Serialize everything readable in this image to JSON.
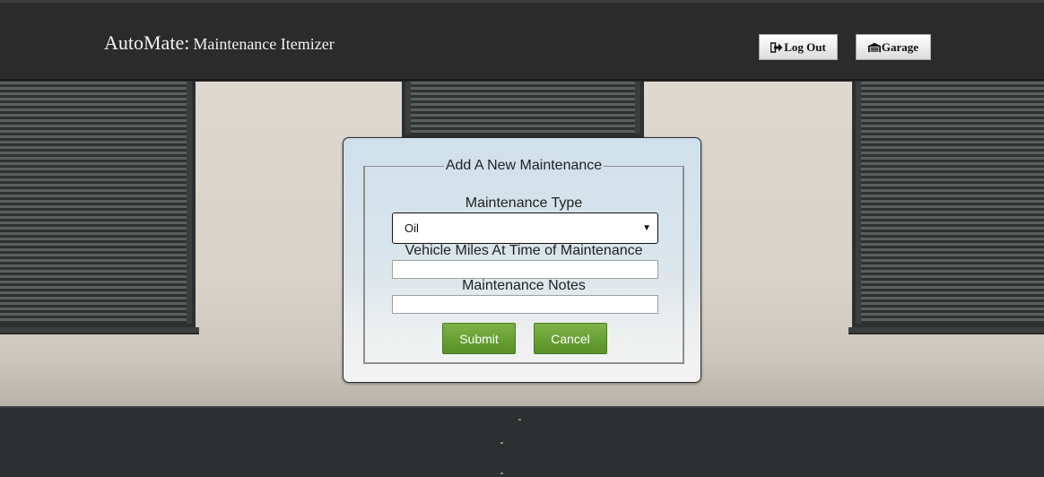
{
  "header": {
    "brand_name": "AutoMate",
    "brand_separator": ":",
    "brand_subtitle": "Maintenance Itemizer",
    "logout_label": "Log Out",
    "garage_label": "Garage"
  },
  "form": {
    "legend": "Add A New Maintenance",
    "type_label": "Maintenance Type",
    "type_selected": "Oil",
    "miles_label": "Vehicle Miles At Time of Maintenance",
    "miles_value": "",
    "notes_label": "Maintenance Notes",
    "notes_value": "",
    "submit_label": "Submit",
    "cancel_label": "Cancel"
  },
  "colors": {
    "header_bg": "#2b2b2b",
    "button_green": "#66a032",
    "dialog_bg_top": "#cfe0ec"
  },
  "icons": {
    "logout": "sign-out-icon",
    "garage": "garage-icon"
  }
}
